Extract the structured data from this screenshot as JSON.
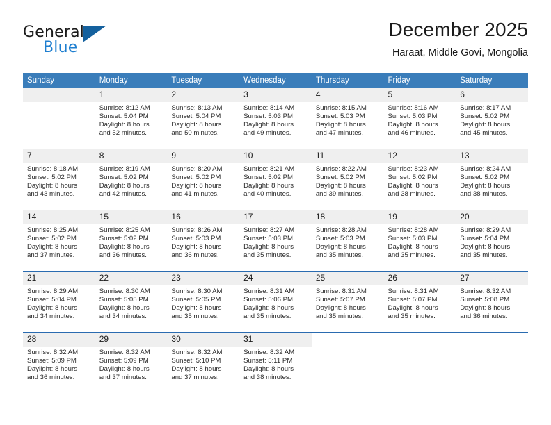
{
  "brand": {
    "name_top": "General",
    "name_bottom": "Blue",
    "triangle_color": "#15619e",
    "blue_color": "#1f7fd0"
  },
  "header": {
    "month_title": "December 2025",
    "location": "Haraat, Middle Govi, Mongolia"
  },
  "theme": {
    "header_row_bg": "#3a7dba",
    "daynum_bg": "#efefef",
    "rule_color": "#2a6bb0",
    "text_color": "#1a1a1a"
  },
  "weekday_headers": [
    "Sunday",
    "Monday",
    "Tuesday",
    "Wednesday",
    "Thursday",
    "Friday",
    "Saturday"
  ],
  "labels": {
    "sunrise_prefix": "Sunrise:",
    "sunset_prefix": "Sunset:",
    "daylight_prefix": "Daylight:"
  },
  "weeks": [
    {
      "days": [
        {
          "num": "",
          "line1": "",
          "line2": "",
          "line3": "",
          "line4": ""
        },
        {
          "num": "1",
          "line1": "Sunrise: 8:12 AM",
          "line2": "Sunset: 5:04 PM",
          "line3": "Daylight: 8 hours",
          "line4": "and 52 minutes."
        },
        {
          "num": "2",
          "line1": "Sunrise: 8:13 AM",
          "line2": "Sunset: 5:04 PM",
          "line3": "Daylight: 8 hours",
          "line4": "and 50 minutes."
        },
        {
          "num": "3",
          "line1": "Sunrise: 8:14 AM",
          "line2": "Sunset: 5:03 PM",
          "line3": "Daylight: 8 hours",
          "line4": "and 49 minutes."
        },
        {
          "num": "4",
          "line1": "Sunrise: 8:15 AM",
          "line2": "Sunset: 5:03 PM",
          "line3": "Daylight: 8 hours",
          "line4": "and 47 minutes."
        },
        {
          "num": "5",
          "line1": "Sunrise: 8:16 AM",
          "line2": "Sunset: 5:03 PM",
          "line3": "Daylight: 8 hours",
          "line4": "and 46 minutes."
        },
        {
          "num": "6",
          "line1": "Sunrise: 8:17 AM",
          "line2": "Sunset: 5:02 PM",
          "line3": "Daylight: 8 hours",
          "line4": "and 45 minutes."
        }
      ]
    },
    {
      "days": [
        {
          "num": "7",
          "line1": "Sunrise: 8:18 AM",
          "line2": "Sunset: 5:02 PM",
          "line3": "Daylight: 8 hours",
          "line4": "and 43 minutes."
        },
        {
          "num": "8",
          "line1": "Sunrise: 8:19 AM",
          "line2": "Sunset: 5:02 PM",
          "line3": "Daylight: 8 hours",
          "line4": "and 42 minutes."
        },
        {
          "num": "9",
          "line1": "Sunrise: 8:20 AM",
          "line2": "Sunset: 5:02 PM",
          "line3": "Daylight: 8 hours",
          "line4": "and 41 minutes."
        },
        {
          "num": "10",
          "line1": "Sunrise: 8:21 AM",
          "line2": "Sunset: 5:02 PM",
          "line3": "Daylight: 8 hours",
          "line4": "and 40 minutes."
        },
        {
          "num": "11",
          "line1": "Sunrise: 8:22 AM",
          "line2": "Sunset: 5:02 PM",
          "line3": "Daylight: 8 hours",
          "line4": "and 39 minutes."
        },
        {
          "num": "12",
          "line1": "Sunrise: 8:23 AM",
          "line2": "Sunset: 5:02 PM",
          "line3": "Daylight: 8 hours",
          "line4": "and 38 minutes."
        },
        {
          "num": "13",
          "line1": "Sunrise: 8:24 AM",
          "line2": "Sunset: 5:02 PM",
          "line3": "Daylight: 8 hours",
          "line4": "and 38 minutes."
        }
      ]
    },
    {
      "days": [
        {
          "num": "14",
          "line1": "Sunrise: 8:25 AM",
          "line2": "Sunset: 5:02 PM",
          "line3": "Daylight: 8 hours",
          "line4": "and 37 minutes."
        },
        {
          "num": "15",
          "line1": "Sunrise: 8:25 AM",
          "line2": "Sunset: 5:02 PM",
          "line3": "Daylight: 8 hours",
          "line4": "and 36 minutes."
        },
        {
          "num": "16",
          "line1": "Sunrise: 8:26 AM",
          "line2": "Sunset: 5:03 PM",
          "line3": "Daylight: 8 hours",
          "line4": "and 36 minutes."
        },
        {
          "num": "17",
          "line1": "Sunrise: 8:27 AM",
          "line2": "Sunset: 5:03 PM",
          "line3": "Daylight: 8 hours",
          "line4": "and 35 minutes."
        },
        {
          "num": "18",
          "line1": "Sunrise: 8:28 AM",
          "line2": "Sunset: 5:03 PM",
          "line3": "Daylight: 8 hours",
          "line4": "and 35 minutes."
        },
        {
          "num": "19",
          "line1": "Sunrise: 8:28 AM",
          "line2": "Sunset: 5:03 PM",
          "line3": "Daylight: 8 hours",
          "line4": "and 35 minutes."
        },
        {
          "num": "20",
          "line1": "Sunrise: 8:29 AM",
          "line2": "Sunset: 5:04 PM",
          "line3": "Daylight: 8 hours",
          "line4": "and 35 minutes."
        }
      ]
    },
    {
      "days": [
        {
          "num": "21",
          "line1": "Sunrise: 8:29 AM",
          "line2": "Sunset: 5:04 PM",
          "line3": "Daylight: 8 hours",
          "line4": "and 34 minutes."
        },
        {
          "num": "22",
          "line1": "Sunrise: 8:30 AM",
          "line2": "Sunset: 5:05 PM",
          "line3": "Daylight: 8 hours",
          "line4": "and 34 minutes."
        },
        {
          "num": "23",
          "line1": "Sunrise: 8:30 AM",
          "line2": "Sunset: 5:05 PM",
          "line3": "Daylight: 8 hours",
          "line4": "and 35 minutes."
        },
        {
          "num": "24",
          "line1": "Sunrise: 8:31 AM",
          "line2": "Sunset: 5:06 PM",
          "line3": "Daylight: 8 hours",
          "line4": "and 35 minutes."
        },
        {
          "num": "25",
          "line1": "Sunrise: 8:31 AM",
          "line2": "Sunset: 5:07 PM",
          "line3": "Daylight: 8 hours",
          "line4": "and 35 minutes."
        },
        {
          "num": "26",
          "line1": "Sunrise: 8:31 AM",
          "line2": "Sunset: 5:07 PM",
          "line3": "Daylight: 8 hours",
          "line4": "and 35 minutes."
        },
        {
          "num": "27",
          "line1": "Sunrise: 8:32 AM",
          "line2": "Sunset: 5:08 PM",
          "line3": "Daylight: 8 hours",
          "line4": "and 36 minutes."
        }
      ]
    },
    {
      "days": [
        {
          "num": "28",
          "line1": "Sunrise: 8:32 AM",
          "line2": "Sunset: 5:09 PM",
          "line3": "Daylight: 8 hours",
          "line4": "and 36 minutes."
        },
        {
          "num": "29",
          "line1": "Sunrise: 8:32 AM",
          "line2": "Sunset: 5:09 PM",
          "line3": "Daylight: 8 hours",
          "line4": "and 37 minutes."
        },
        {
          "num": "30",
          "line1": "Sunrise: 8:32 AM",
          "line2": "Sunset: 5:10 PM",
          "line3": "Daylight: 8 hours",
          "line4": "and 37 minutes."
        },
        {
          "num": "31",
          "line1": "Sunrise: 8:32 AM",
          "line2": "Sunset: 5:11 PM",
          "line3": "Daylight: 8 hours",
          "line4": "and 38 minutes."
        },
        {
          "num": "",
          "line1": "",
          "line2": "",
          "line3": "",
          "line4": ""
        },
        {
          "num": "",
          "line1": "",
          "line2": "",
          "line3": "",
          "line4": ""
        },
        {
          "num": "",
          "line1": "",
          "line2": "",
          "line3": "",
          "line4": ""
        }
      ]
    }
  ]
}
